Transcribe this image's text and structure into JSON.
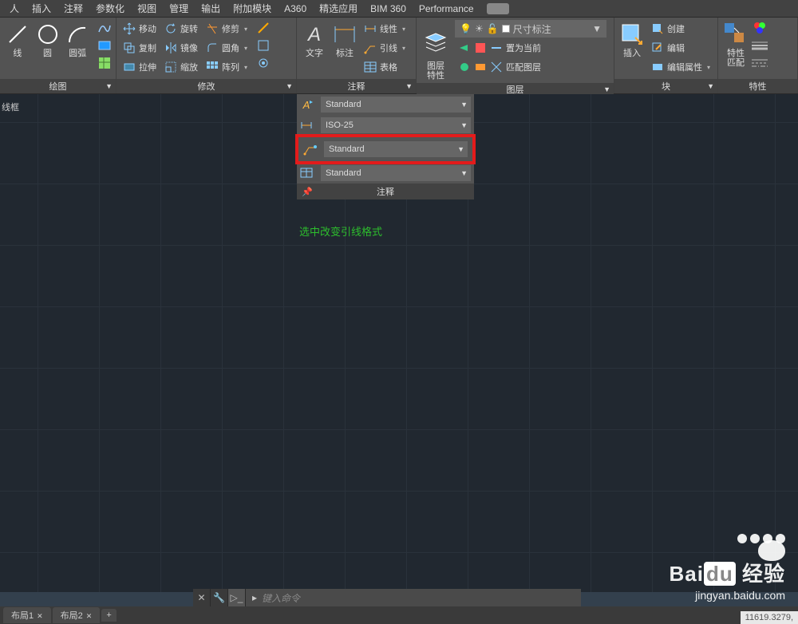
{
  "menu": [
    "人",
    "插入",
    "注释",
    "参数化",
    "视图",
    "管理",
    "输出",
    "附加模块",
    "A360",
    "精选应用",
    "BIM 360",
    "Performance"
  ],
  "ribbon": {
    "draw": {
      "items": [
        "线",
        "圆",
        "圆弧"
      ],
      "title": "绘图"
    },
    "modify": {
      "rows": [
        [
          "移动",
          "旋转",
          "修剪"
        ],
        [
          "复制",
          "镜像",
          "圆角"
        ],
        [
          "拉伸",
          "缩放",
          "阵列"
        ]
      ],
      "title": "修改"
    },
    "annot": {
      "text": "文字",
      "dim": "标注",
      "right": [
        "线性",
        "引线",
        "表格"
      ],
      "title": "注释"
    },
    "layers": {
      "big": "图层\n特性",
      "dropdown": "尺寸标注",
      "actions": [
        "置为当前",
        "匹配图层"
      ],
      "title": "图层"
    },
    "block": {
      "big": "插入",
      "items": [
        "创建",
        "编辑",
        "编辑属性"
      ],
      "title": "块"
    },
    "props": {
      "big": "特性\n匹配",
      "title": "特性"
    }
  },
  "flyout": {
    "rows": [
      "Standard",
      "ISO-25",
      "Standard",
      "Standard"
    ],
    "footer": "注释"
  },
  "canvas": {
    "corner": "线框",
    "note": "选中改变引线格式"
  },
  "cmd": {
    "placeholder": "键入命令"
  },
  "tabs": [
    "布局1",
    "布局2"
  ],
  "coords": "11619.3279,",
  "wm": {
    "brand_a": "Bai",
    "brand_b": "du",
    "brand_c": "经验",
    "sub": "jingyan.baidu.com"
  }
}
